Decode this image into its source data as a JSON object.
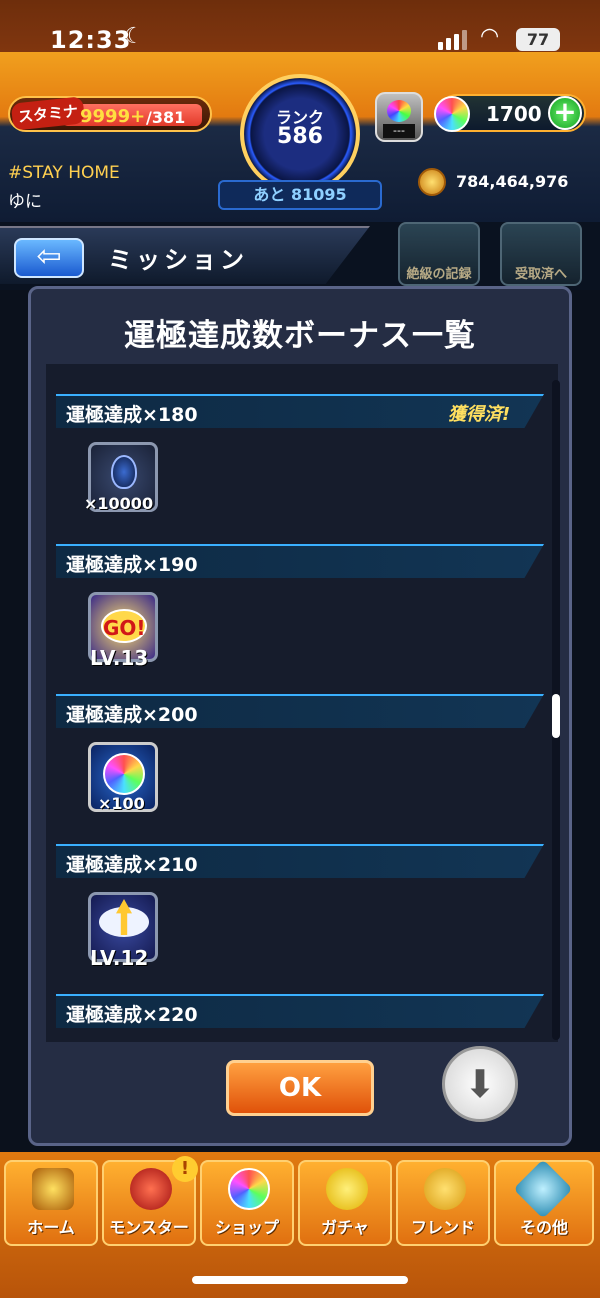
{
  "status_bar": {
    "time": "12:33",
    "battery": "77"
  },
  "hud": {
    "stamina_tag": "スタミナ",
    "stamina_value": "9999+",
    "stamina_max": "/381",
    "rank_label": "ランク",
    "rank_value": "586",
    "next_rank": "あと 81095",
    "orb_machine_count": "---",
    "orb_count": "1700",
    "hashtag": "#STAY HOME",
    "username": "ゆに",
    "gold": "784,464,976"
  },
  "header": {
    "title": "ミッション",
    "shortcut_1": "絶級の記録",
    "shortcut_2": "受取済へ"
  },
  "modal": {
    "title": "運極達成数ボーナス一覧",
    "rows": [
      {
        "label": "運極達成×180",
        "status": "獲得済!",
        "reward_caption": "×10000",
        "icon": "flame-icon"
      },
      {
        "label": "運極達成×190",
        "status": "",
        "reward_caption": "LV.13",
        "icon": "go-badge-icon"
      },
      {
        "label": "運極達成×200",
        "status": "",
        "reward_caption": "×100",
        "icon": "rainbow-orb-icon"
      },
      {
        "label": "運極達成×210",
        "status": "",
        "reward_caption": "LV.12",
        "icon": "winged-arrow-icon"
      },
      {
        "label": "運極達成×220",
        "status": "",
        "reward_caption": "",
        "icon": ""
      }
    ],
    "ok_label": "OK",
    "scroll_position": 0.45
  },
  "tabs": [
    {
      "label": "ホーム",
      "icon": "home-icon"
    },
    {
      "label": "モンスター",
      "icon": "monster-icon"
    },
    {
      "label": "ショップ",
      "icon": "shop-orb-icon"
    },
    {
      "label": "ガチャ",
      "icon": "gacha-icon"
    },
    {
      "label": "フレンド",
      "icon": "friend-icon"
    },
    {
      "label": "その他",
      "icon": "other-icon"
    }
  ],
  "colors": {
    "accent_orange": "#e37a10",
    "modal_bg": "#252d44",
    "acquired_yellow": "#ffe060"
  }
}
